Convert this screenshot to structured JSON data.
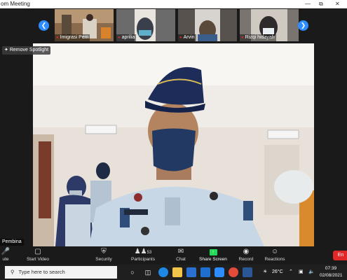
{
  "window": {
    "title": "om Meeting",
    "min_icon": "minimize-icon",
    "max_icon": "restore-icon",
    "close_icon": "close-icon"
  },
  "participants": [
    {
      "name": "Imigrasi Pem",
      "muted": true
    },
    {
      "name": "aprilia",
      "muted": true
    },
    {
      "name": "Arvin",
      "muted": true
    },
    {
      "name": "Rizqi hidayah",
      "muted": true
    }
  ],
  "spotlight": {
    "label": "Remove Spotlight"
  },
  "speaker": {
    "name": "Pembina"
  },
  "toolbar": {
    "mute": "ute",
    "start_video": "Start Video",
    "security": "Security",
    "participants": "Participants",
    "participants_count": "53",
    "chat": "Chat",
    "share_screen": "Share Screen",
    "record": "Record",
    "reactions": "Reactions",
    "end": "En",
    "share_color": "#23d959",
    "end_color": "#e02828"
  },
  "taskbar": {
    "search_placeholder": "Type here to search",
    "weather": "26°C",
    "time": "07:39",
    "date": "02/08/2021"
  }
}
